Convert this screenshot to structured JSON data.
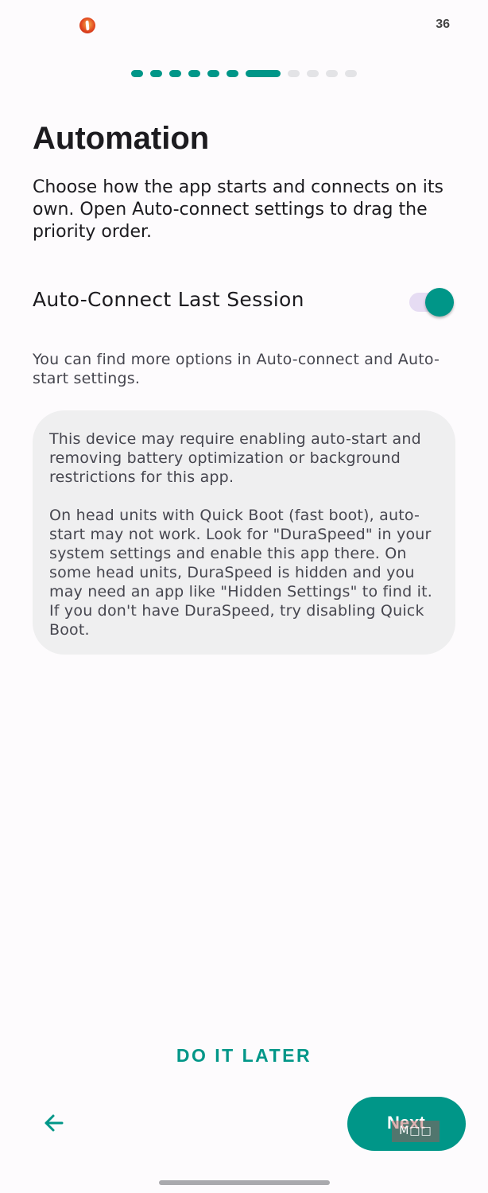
{
  "status_bar": {
    "time": "36"
  },
  "progress": {
    "total_steps": 12,
    "current_step": 7
  },
  "page": {
    "title": "Automation",
    "intro": "Choose how the app starts and connects on its own. Open Auto-connect settings to drag the priority order."
  },
  "auto_connect": {
    "label": "Auto-Connect Last Session",
    "enabled": true
  },
  "hint": "You can find more options in Auto-connect and Auto-start settings.",
  "notice": {
    "paragraph_1": "This device may require enabling auto-start and removing battery optimization or background restrictions for this app.",
    "paragraph_2": "On head units with Quick Boot (fast boot), auto-start may not work. Look for \"DuraSpeed\" in your system settings and enable this app there. On some head units, DuraSpeed is hidden and you may need an app like \"Hidden Settings\" to find it. If you don't have DuraSpeed, try disabling Quick Boot."
  },
  "actions": {
    "later_label": "DO IT LATER",
    "next_label": "Next",
    "overlay_badge": "M□□"
  },
  "colors": {
    "accent": "#009688",
    "switch_track": "#e6dcf3",
    "notice_bg": "#efeff0"
  },
  "icons": {
    "back": "arrow-left-icon",
    "app": "app-logo-icon"
  }
}
